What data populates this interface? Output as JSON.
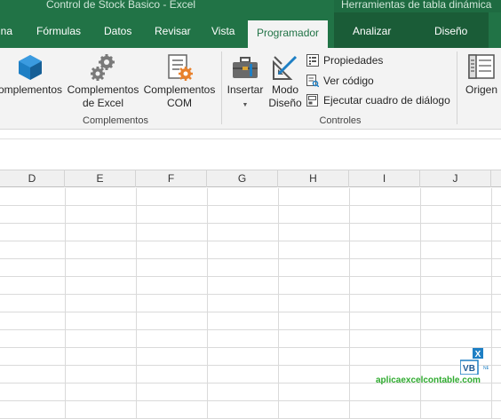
{
  "title": {
    "document": "Control de Stock Basico  -  Excel",
    "contextual": "Herramientas de tabla dinámica"
  },
  "tabs": [
    {
      "label": "ina",
      "active": false
    },
    {
      "label": "Fórmulas",
      "active": false
    },
    {
      "label": "Datos",
      "active": false
    },
    {
      "label": "Revisar",
      "active": false
    },
    {
      "label": "Vista",
      "active": false
    },
    {
      "label": "Programador",
      "active": true
    },
    {
      "label": "Analizar",
      "active": false,
      "contextual": true
    },
    {
      "label": "Diseño",
      "active": false,
      "contextual": true
    }
  ],
  "ribbon": {
    "complementos_group": {
      "label": "Complementos",
      "buttons": {
        "complementos": "omplementos",
        "excel_line1": "Complementos",
        "excel_line2": "de Excel",
        "com_line1": "Complementos",
        "com_line2": "COM"
      }
    },
    "controles_group": {
      "label": "Controles",
      "insertar": "Insertar",
      "modo_line1": "Modo",
      "modo_line2": "Diseño",
      "propiedades": "Propiedades",
      "ver_codigo": "Ver código",
      "ejecutar": "Ejecutar cuadro de diálogo"
    },
    "xml_group": {
      "origen": "Origen"
    }
  },
  "columns": [
    "D",
    "E",
    "F",
    "G",
    "H",
    "I",
    "J"
  ],
  "watermark": {
    "text": "aplicaexcelcontable.com"
  },
  "colors": {
    "excel_green": "#217346",
    "watermark_green": "#2eaa2e"
  }
}
